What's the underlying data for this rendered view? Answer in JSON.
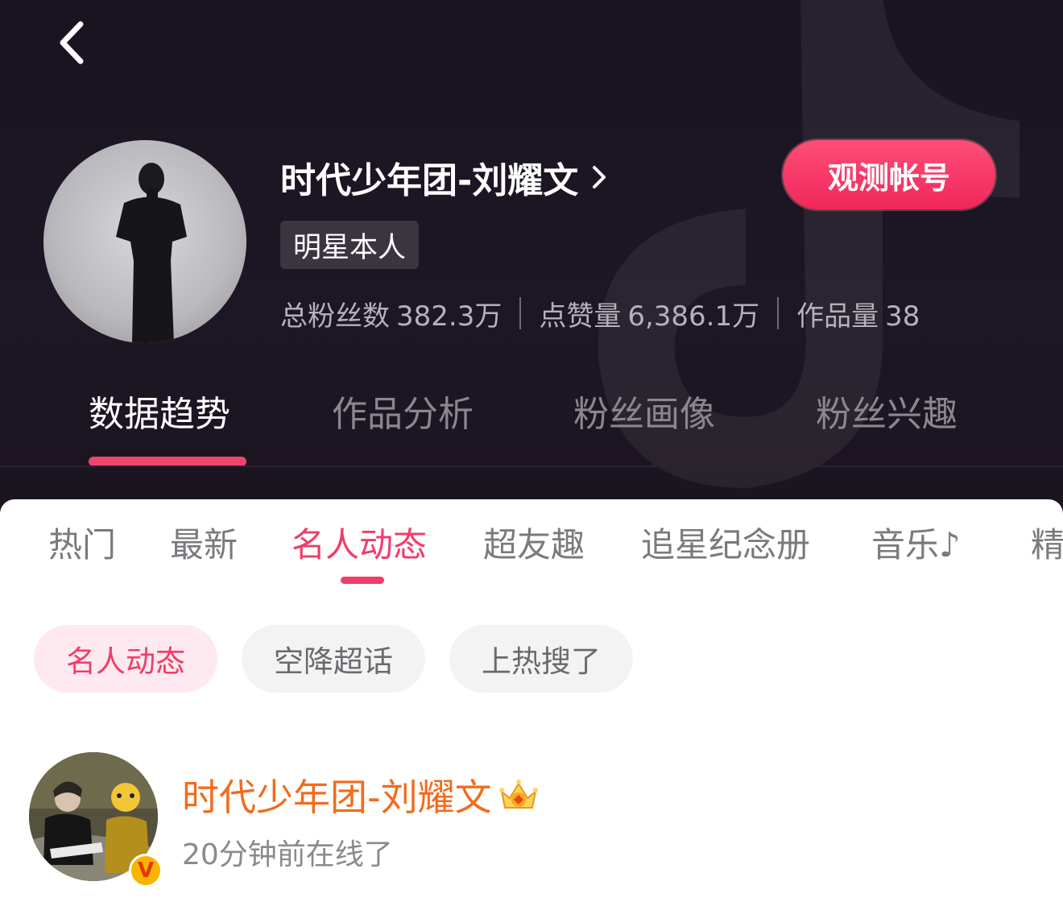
{
  "header": {
    "profile_name": "时代少年团-刘耀文",
    "observe_button": "观测帐号",
    "badge": "明星本人",
    "stats": [
      {
        "label": "总粉丝数",
        "value": "382.3万"
      },
      {
        "label": "点赞量",
        "value": "6,386.1万"
      },
      {
        "label": "作品量",
        "value": "38"
      }
    ],
    "tabs": [
      {
        "label": "数据趋势",
        "active": true
      },
      {
        "label": "作品分析",
        "active": false
      },
      {
        "label": "粉丝画像",
        "active": false
      },
      {
        "label": "粉丝兴趣",
        "active": false
      }
    ]
  },
  "sub_tabs": [
    {
      "label": "热门"
    },
    {
      "label": "最新"
    },
    {
      "label": "名人动态",
      "active": true
    },
    {
      "label": "超友趣"
    },
    {
      "label": "追星纪念册"
    },
    {
      "label": "音乐♪"
    },
    {
      "label": "精"
    }
  ],
  "chips": [
    {
      "label": "名人动态",
      "active": true
    },
    {
      "label": "空降超话"
    },
    {
      "label": "上热搜了"
    }
  ],
  "post": {
    "author": "时代少年团-刘耀文",
    "status": "20分钟前在线了",
    "verified_mark": "V"
  },
  "colors": {
    "accent_pink": "#f13c6a",
    "button_pink": "#f0285a",
    "author_orange": "#f26b1d",
    "header_bg": "#1b1520"
  },
  "icons": [
    "back-arrow-icon",
    "chevron-right-icon",
    "crown-icon",
    "verified-icon",
    "watermark-logo-icon"
  ]
}
